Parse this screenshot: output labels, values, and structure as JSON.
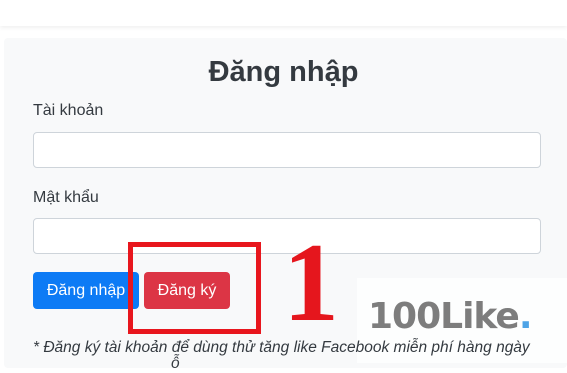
{
  "form": {
    "title": "Đăng nhập",
    "username_label": "Tài khoản",
    "username_value": "",
    "password_label": "Mật khẩu",
    "password_value": "",
    "login_button": "Đăng nhập",
    "register_button": "Đăng ký",
    "note": "* Đăng ký tài khoản để dùng thử tăng like Facebook miễn phí hàng ngày",
    "note_continuation": "ỗ"
  },
  "annotation": {
    "step_number": "1",
    "color": "#e8161d"
  },
  "watermark": {
    "text": "100Like",
    "dot": "."
  },
  "colors": {
    "primary": "#0d7bf5",
    "danger": "#dc3545"
  }
}
